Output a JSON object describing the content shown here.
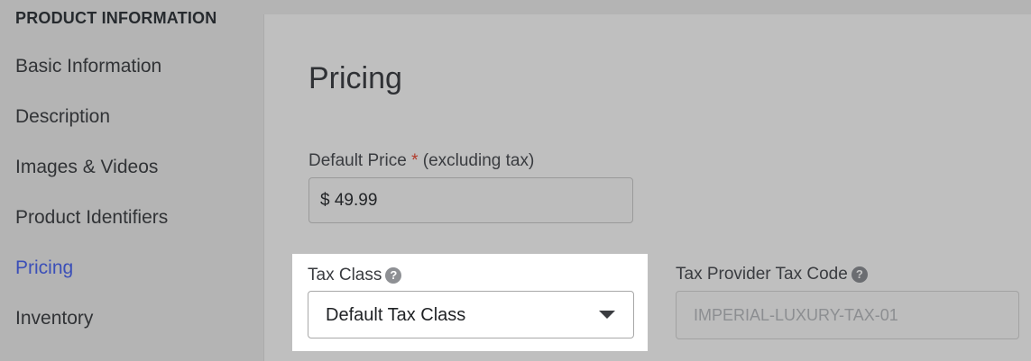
{
  "sidebar": {
    "heading": "PRODUCT INFORMATION",
    "items": [
      {
        "label": "Basic Information"
      },
      {
        "label": "Description"
      },
      {
        "label": "Images & Videos"
      },
      {
        "label": "Product Identifiers"
      },
      {
        "label": "Pricing",
        "active": true
      },
      {
        "label": "Inventory"
      }
    ]
  },
  "pricing": {
    "title": "Pricing",
    "default_price": {
      "label": "Default Price",
      "required_mark": "*",
      "label_suffix": "(excluding tax)",
      "value": "$ 49.99"
    },
    "tax_class": {
      "label": "Tax Class",
      "help_icon": "?",
      "selected": "Default Tax Class"
    },
    "tax_provider_code": {
      "label": "Tax Provider Tax Code",
      "help_icon": "?",
      "value": "IMPERIAL-LUXURY-TAX-01"
    }
  },
  "colors": {
    "active_nav": "#3b4fb8",
    "required": "#b23a2a"
  }
}
